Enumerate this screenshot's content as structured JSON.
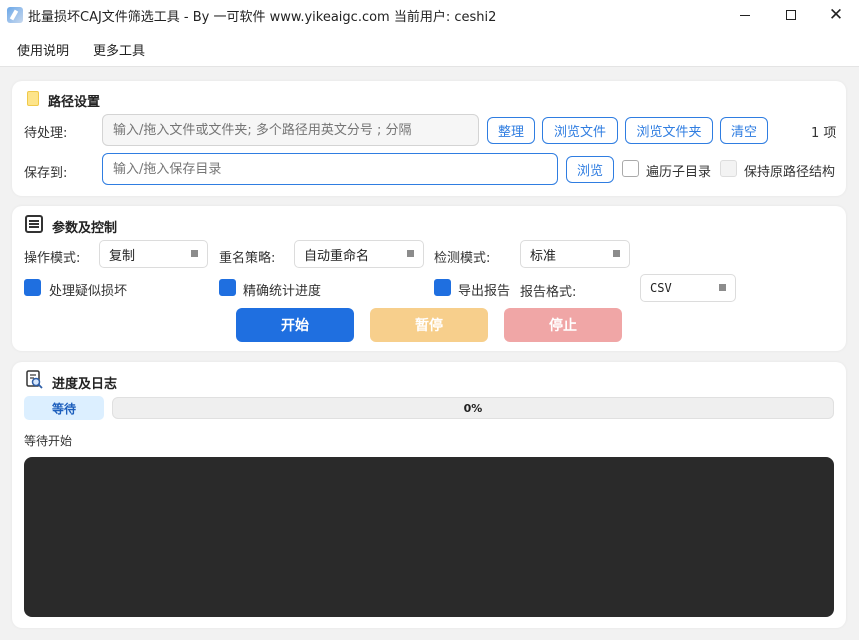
{
  "window": {
    "title": "批量损坏CAJ文件筛选工具 - By 一可软件 www.yikeaigc.com 当前用户: ceshi2",
    "close_glyph": "✕"
  },
  "menu": [
    "使用说明",
    "更多工具"
  ],
  "path_section": {
    "title": "路径设置",
    "pending_label": "待处理:",
    "pending_placeholder": "输入/拖入文件或文件夹; 多个路径用英文分号 ; 分隔",
    "organize": "整理",
    "browse_files": "浏览文件",
    "browse_folder": "浏览文件夹",
    "clear": "清空",
    "count": "1 项",
    "save_label": "保存到:",
    "save_placeholder": "输入/拖入保存目录",
    "browse": "浏览",
    "traverse_subdirs": "遍历子目录",
    "keep_structure": "保持原路径结构"
  },
  "params_section": {
    "title": "参数及控制",
    "mode_label": "操作模式:",
    "mode_value": "复制",
    "rename_label": "重名策略:",
    "rename_value": "自动重命名",
    "detect_label": "检测模式:",
    "detect_value": "标准",
    "handle_suspect": "处理疑似损坏",
    "precise_progress": "精确统计进度",
    "export_report": "导出报告",
    "report_format_label": "报告格式:",
    "report_format_value": "CSV",
    "start": "开始",
    "pause": "暂停",
    "stop": "停止"
  },
  "progress_section": {
    "title": "进度及日志",
    "status": "等待",
    "progress": 0,
    "progress_text": "0%",
    "status_message": "等待开始",
    "log_lines": []
  },
  "colors": {
    "accent": "#1f6fe0",
    "pause": "#f7cf8c",
    "stop": "#f0a6a6",
    "log_bg": "#2a2a2a"
  },
  "icons": {
    "app": "app-logo-icon",
    "path": "folder-icon",
    "params": "list-icon",
    "log": "log-search-icon"
  }
}
